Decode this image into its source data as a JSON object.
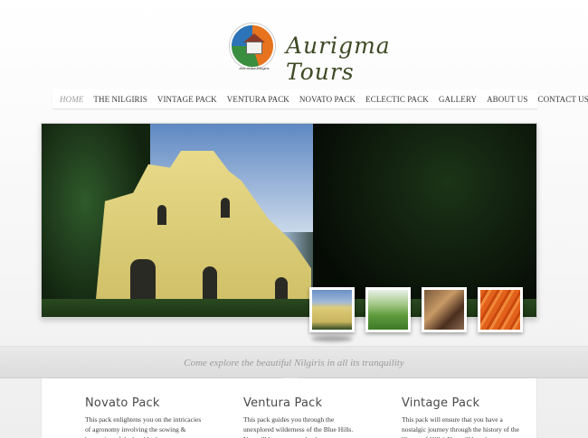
{
  "brand": {
    "name": "Aurigma Tours",
    "badge_tagline": "Arts of the Ellugins"
  },
  "nav": {
    "items": [
      {
        "label": "HOME",
        "active": true
      },
      {
        "label": "THE NILGIRIS",
        "active": false
      },
      {
        "label": "VINTAGE PACK",
        "active": false
      },
      {
        "label": "VENTURA PACK",
        "active": false
      },
      {
        "label": "NOVATO PACK",
        "active": false
      },
      {
        "label": "ECLECTIC PACK",
        "active": false
      },
      {
        "label": "GALLERY",
        "active": false
      },
      {
        "label": "ABOUT US",
        "active": false
      },
      {
        "label": "CONTACT US",
        "active": false
      }
    ]
  },
  "slider": {
    "thumbnails": [
      {
        "name": "church-thumb",
        "active": true
      },
      {
        "name": "hills-thumb",
        "active": false
      },
      {
        "name": "market-thumb",
        "active": false
      },
      {
        "name": "carrots-thumb",
        "active": false
      }
    ]
  },
  "band": {
    "tagline": "Come explore the beautiful Nilgiris in all its tranquility"
  },
  "packs": [
    {
      "title": "Novato Pack",
      "text": "This pack enlightens you on the intricacies of agronomy involving the sowing & harvesting of the local herbs"
    },
    {
      "title": "Ventura Pack",
      "text": "This pack guides you through the unexplored wilderness of the Blue Hills. You will be transported to heaven on"
    },
    {
      "title": "Vintage Pack",
      "text": "This pack will ensure that you have a nostalgic journey through the history of the 'Queen of Hills'. You will be taken to"
    }
  ],
  "colors": {
    "brand_text": "#3d4a24",
    "nav_active": "#9a9a9a",
    "tagline": "#9b9b9b"
  }
}
